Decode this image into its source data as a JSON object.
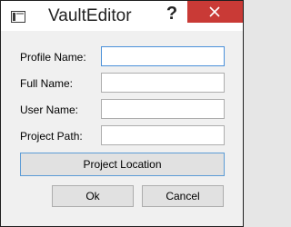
{
  "window": {
    "title": "VaultEditor",
    "help_glyph": "?",
    "close_icon": "close-icon"
  },
  "form": {
    "profile_name": {
      "label": "Profile Name:",
      "value": ""
    },
    "full_name": {
      "label": "Full Name:",
      "value": ""
    },
    "user_name": {
      "label": "User Name:",
      "value": ""
    },
    "project_path": {
      "label": "Project Path:",
      "value": ""
    }
  },
  "buttons": {
    "project_location": "Project Location",
    "ok": "Ok",
    "cancel": "Cancel"
  },
  "colors": {
    "close_button": "#c93a36",
    "focus_border": "#4a90d9"
  }
}
